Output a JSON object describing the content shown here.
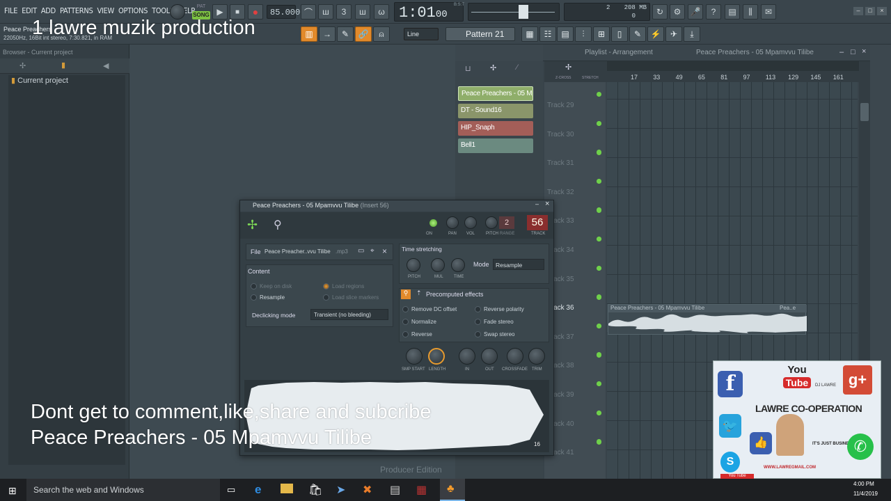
{
  "menu": [
    "FILE",
    "EDIT",
    "ADD",
    "PATTERNS",
    "VIEW",
    "OPTIONS",
    "TOOLS",
    "HELP"
  ],
  "transport": {
    "mode": "SONG",
    "pat_small": "PAT",
    "tempo": "85.000",
    "time": "1:01",
    "time_sub": "00",
    "time_unit": "B:S:T",
    "mem": "208 MB",
    "cpu_val": "2",
    "poly_val": "0"
  },
  "hint": {
    "line1": "Peace Preachers",
    "line2": "22050Hz, 16Bit int stereo, 7:30.821, in RAM"
  },
  "snap": "Line",
  "pattern": "Pattern 21",
  "browser": {
    "title": "Browser - Current project",
    "item": "Current project"
  },
  "channels": [
    {
      "name": "Peace Preachers - 05 Mp...",
      "color": "#8fae6a"
    },
    {
      "name": "DT - Sound16",
      "color": "#8a956a"
    },
    {
      "name": "HIP_Snaph",
      "color": "#a35e58"
    },
    {
      "name": "Bell1",
      "color": "#6b8a80"
    }
  ],
  "playlist": {
    "title": "Playlist - Arrangement",
    "song": "Peace Preachers - 05 Mpamvvu Tilibe",
    "zcross": "Z-CROSS",
    "stretch": "STRETCH",
    "ruler": [
      "17",
      "33",
      "49",
      "65",
      "81",
      "97",
      "113",
      "129",
      "145",
      "161"
    ],
    "tracks": [
      "Track 29",
      "Track 30",
      "Track 31",
      "Track 32",
      "Track 33",
      "Track 34",
      "Track 35",
      "Track 36",
      "Track 37",
      "Track 38",
      "Track 39",
      "Track 40",
      "Track 41"
    ],
    "clip": "Peace Preachers - 05 Mpamvvu Tilibe",
    "clip2": "Pea..e"
  },
  "sampler": {
    "title": "Peace Preachers - 05 Mpamvvu Tilibe",
    "insert": "(Insert 56)",
    "on": "ON",
    "pan": "PAN",
    "vol": "VOL",
    "pitch": "PITCH",
    "range": "RANGE",
    "range_val": "2",
    "track": "TRACK",
    "track_val": "56",
    "file_label": "File",
    "file_name": "Peace Preacher..vvu Tilibe",
    "file_ext": ".mp3",
    "content": "Content",
    "keep_on_disk": "Keep on disk",
    "load_regions": "Load regions",
    "resample": "Resample",
    "load_slice": "Load slice markers",
    "declicking": "Declicking mode",
    "declick_val": "Transient (no bleeding)",
    "ts": "Time stretching",
    "ts_pitch": "PITCH",
    "ts_mul": "MUL",
    "ts_time": "TIME",
    "mode": "Mode",
    "mode_val": "Resample",
    "precomp": "Precomputed effects",
    "remove_dc": "Remove DC offset",
    "reverse_pol": "Reverse polarity",
    "normalize": "Normalize",
    "fade_stereo": "Fade stereo",
    "reverse": "Reverse",
    "swap_stereo": "Swap stereo",
    "k_smp": "SMP START",
    "k_len": "LENGTH",
    "k_in": "IN",
    "k_out": "OUT",
    "k_cross": "CROSSFADE",
    "k_trim": "TRIM",
    "wave_num": "16"
  },
  "producer": "Producer Edition",
  "overlay": {
    "top": "1 lawre muzik production",
    "line1": "Dont get to comment,like,share and subcribe",
    "line2": "Peace Preachers - 05 Mpamvvu Tilibe"
  },
  "promo": {
    "brand": "LAWRE CO-OPERATION",
    "youtube_top": "You",
    "youtube_bottom": "Tube",
    "biz": "IT'S JUST BUSINESS",
    "site": "WWW.LAWREGMAIL.COM",
    "lawre": "DJ LAWRE",
    "bottom_yt": "You Tube"
  },
  "taskbar": {
    "search": "Search the web and Windows",
    "time": "4:00 PM",
    "date": "11/4/2019"
  }
}
